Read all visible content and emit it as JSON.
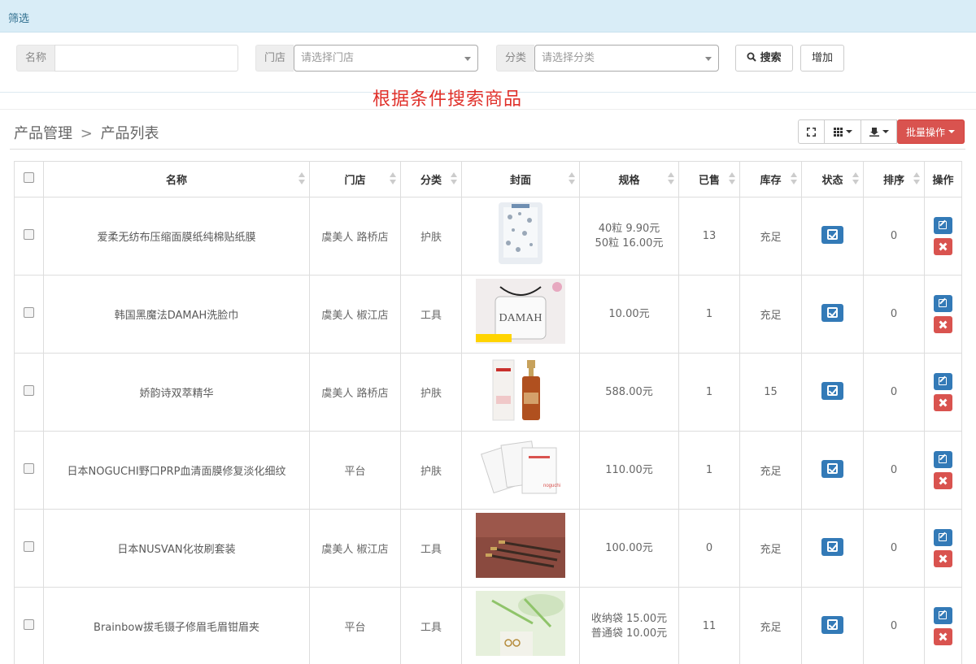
{
  "filter": {
    "title": "筛选",
    "name_label": "名称",
    "name_value": "",
    "store_label": "门店",
    "store_placeholder": "请选择门店",
    "category_label": "分类",
    "category_placeholder": "请选择分类",
    "search_label": "搜索",
    "add_label": "增加"
  },
  "annotation": "根据条件搜索商品",
  "breadcrumb": {
    "parent": "产品管理",
    "separator": ">",
    "current": "产品列表"
  },
  "toolbar": {
    "batch_label": "批量操作"
  },
  "columns": [
    "名称",
    "门店",
    "分类",
    "封面",
    "规格",
    "已售",
    "库存",
    "状态",
    "排序",
    "操作"
  ],
  "rows": [
    {
      "name": "爱柔无纺布压缩面膜纸纯棉贴纸膜",
      "store": "虞美人 路桥店",
      "category": "护肤",
      "spec": [
        "40粒 9.90元",
        "50粒 16.00元"
      ],
      "sold": "13",
      "stock": "充足",
      "sort": "0",
      "cover": "cover-face-mask-pack"
    },
    {
      "name": "韩国黑魔法DAMAH洗脸巾",
      "store": "虞美人 椒江店",
      "category": "工具",
      "spec": [
        "10.00元"
      ],
      "sold": "1",
      "stock": "充足",
      "sort": "0",
      "cover": "cover-damah-bag"
    },
    {
      "name": "娇韵诗双萃精华",
      "store": "虞美人 路桥店",
      "category": "护肤",
      "spec": [
        "588.00元"
      ],
      "sold": "1",
      "stock": "15",
      "sort": "0",
      "cover": "cover-serum-bottle"
    },
    {
      "name": "日本NOGUCHI野口PRP血清面膜修复淡化细纹",
      "store": "平台",
      "category": "护肤",
      "spec": [
        "110.00元"
      ],
      "sold": "1",
      "stock": "充足",
      "sort": "0",
      "cover": "cover-mask-sheets"
    },
    {
      "name": "日本NUSVAN化妆刷套装",
      "store": "虞美人 椒江店",
      "category": "工具",
      "spec": [
        "100.00元"
      ],
      "sold": "0",
      "stock": "充足",
      "sort": "0",
      "cover": "cover-brush-set"
    },
    {
      "name": "Brainbow拔毛镊子修眉毛眉钳眉夹",
      "store": "平台",
      "category": "工具",
      "spec": [
        "收纳袋 15.00元",
        "普通袋 10.00元"
      ],
      "sold": "11",
      "stock": "充足",
      "sort": "0",
      "cover": "cover-tweezers"
    }
  ]
}
